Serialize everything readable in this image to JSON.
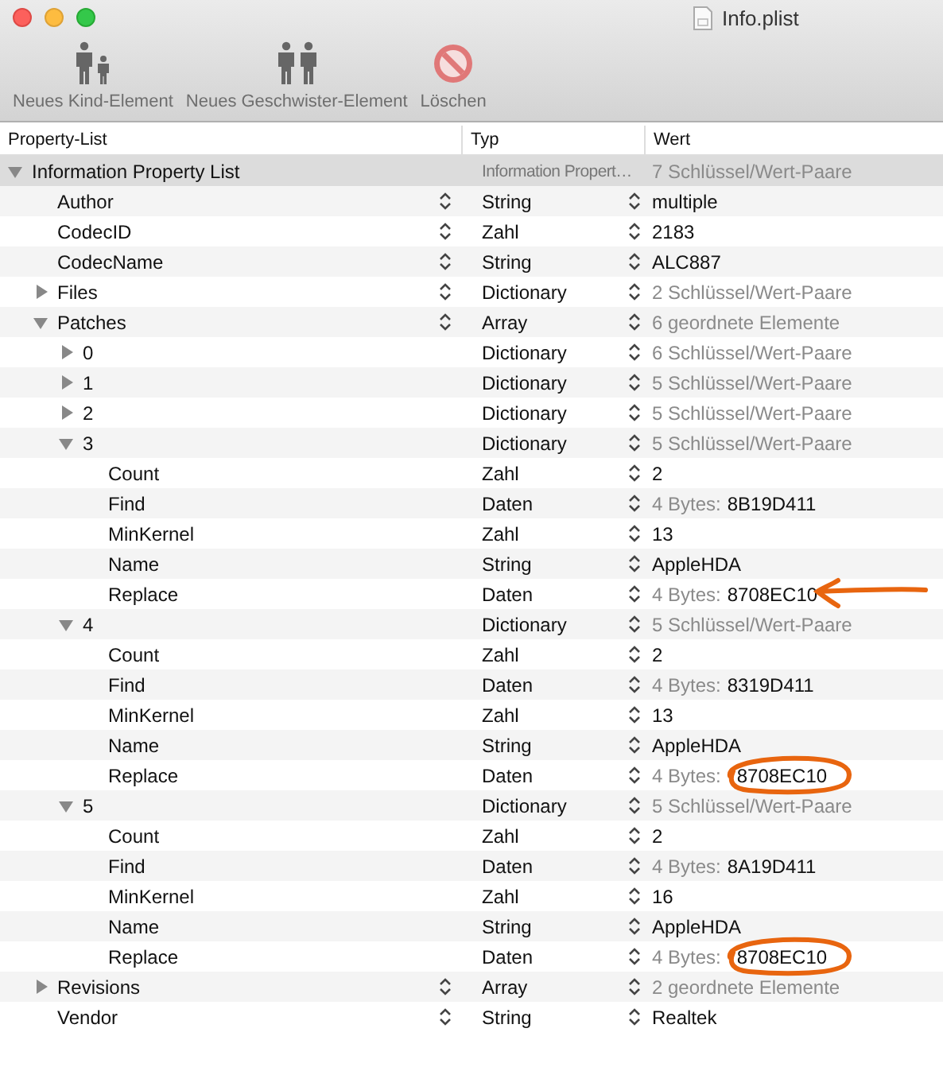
{
  "window": {
    "title": "Info.plist"
  },
  "toolbar": [
    {
      "kind": "child",
      "label": "Neues Kind-Element"
    },
    {
      "kind": "sibling",
      "label": "Neues Geschwister-Element"
    },
    {
      "kind": "delete",
      "label": "Löschen"
    }
  ],
  "columns": [
    "Property-List",
    "Typ",
    "Wert"
  ],
  "tree": [
    {
      "key": "Information Property List",
      "type": "Information Propert…",
      "value": "7 Schlüssel/Wert-Paare",
      "kind": "summary",
      "selected": true,
      "expanded": true,
      "children": [
        {
          "key": "Author",
          "type": "String",
          "value": "multiple",
          "kind": "plain",
          "selected": false
        },
        {
          "key": "CodecID",
          "type": "Zahl",
          "value": "2183",
          "kind": "plain",
          "selected": false
        },
        {
          "key": "CodecName",
          "type": "String",
          "value": "ALC887",
          "kind": "plain",
          "selected": false
        },
        {
          "key": "Files",
          "type": "Dictionary",
          "value": "2 Schlüssel/Wert-Paare",
          "kind": "summary",
          "selected": false,
          "expanded": false
        },
        {
          "key": "Patches",
          "type": "Array",
          "value": "6 geordnete Elemente",
          "kind": "summary",
          "selected": false,
          "expanded": true,
          "children": [
            {
              "key": "0",
              "type": "Dictionary",
              "value": "6 Schlüssel/Wert-Paare",
              "kind": "summary",
              "selected": false,
              "expanded": false
            },
            {
              "key": "1",
              "type": "Dictionary",
              "value": "5 Schlüssel/Wert-Paare",
              "kind": "summary",
              "selected": false,
              "expanded": false
            },
            {
              "key": "2",
              "type": "Dictionary",
              "value": "5 Schlüssel/Wert-Paare",
              "kind": "summary",
              "selected": false,
              "expanded": false
            },
            {
              "key": "3",
              "type": "Dictionary",
              "value": "5 Schlüssel/Wert-Paare",
              "kind": "summary",
              "selected": false,
              "expanded": true,
              "children": [
                {
                  "key": "Count",
                  "type": "Zahl",
                  "value": "2",
                  "kind": "plain",
                  "selected": false
                },
                {
                  "key": "Find",
                  "type": "Daten",
                  "prefix": "4 Bytes:",
                  "value": "8B19D411",
                  "kind": "bytes",
                  "selected": false
                },
                {
                  "key": "MinKernel",
                  "type": "Zahl",
                  "value": "13",
                  "kind": "plain",
                  "selected": false
                },
                {
                  "key": "Name",
                  "type": "String",
                  "value": "AppleHDA",
                  "kind": "plain",
                  "selected": false
                },
                {
                  "key": "Replace",
                  "type": "Daten",
                  "prefix": "4 Bytes:",
                  "value": "8708EC10",
                  "kind": "bytes",
                  "selected": false,
                  "arrow": true
                }
              ]
            },
            {
              "key": "4",
              "type": "Dictionary",
              "value": "5 Schlüssel/Wert-Paare",
              "kind": "summary",
              "selected": false,
              "expanded": true,
              "children": [
                {
                  "key": "Count",
                  "type": "Zahl",
                  "value": "2",
                  "kind": "plain",
                  "selected": false
                },
                {
                  "key": "Find",
                  "type": "Daten",
                  "prefix": "4 Bytes:",
                  "value": "8319D411",
                  "kind": "bytes",
                  "selected": false
                },
                {
                  "key": "MinKernel",
                  "type": "Zahl",
                  "value": "13",
                  "kind": "plain",
                  "selected": false
                },
                {
                  "key": "Name",
                  "type": "String",
                  "value": "AppleHDA",
                  "kind": "plain",
                  "selected": false
                },
                {
                  "key": "Replace",
                  "type": "Daten",
                  "prefix": "4 Bytes:",
                  "value": "8708EC10",
                  "kind": "bytes",
                  "selected": false,
                  "circled": true
                }
              ]
            },
            {
              "key": "5",
              "type": "Dictionary",
              "value": "5 Schlüssel/Wert-Paare",
              "kind": "summary",
              "selected": false,
              "expanded": true,
              "children": [
                {
                  "key": "Count",
                  "type": "Zahl",
                  "value": "2",
                  "kind": "plain",
                  "selected": false
                },
                {
                  "key": "Find",
                  "type": "Daten",
                  "prefix": "4 Bytes:",
                  "value": "8A19D411",
                  "kind": "bytes",
                  "selected": false
                },
                {
                  "key": "MinKernel",
                  "type": "Zahl",
                  "value": "16",
                  "kind": "plain",
                  "selected": false
                },
                {
                  "key": "Name",
                  "type": "String",
                  "value": "AppleHDA",
                  "kind": "plain",
                  "selected": false
                },
                {
                  "key": "Replace",
                  "type": "Daten",
                  "prefix": "4 Bytes:",
                  "value": "8708EC10",
                  "kind": "bytes",
                  "selected": false,
                  "circled": true
                }
              ]
            }
          ]
        },
        {
          "key": "Revisions",
          "type": "Array",
          "value": "2 geordnete Elemente",
          "kind": "summary",
          "selected": false,
          "expanded": false
        },
        {
          "key": "Vendor",
          "type": "String",
          "value": "Realtek",
          "kind": "plain",
          "selected": false
        }
      ]
    }
  ]
}
